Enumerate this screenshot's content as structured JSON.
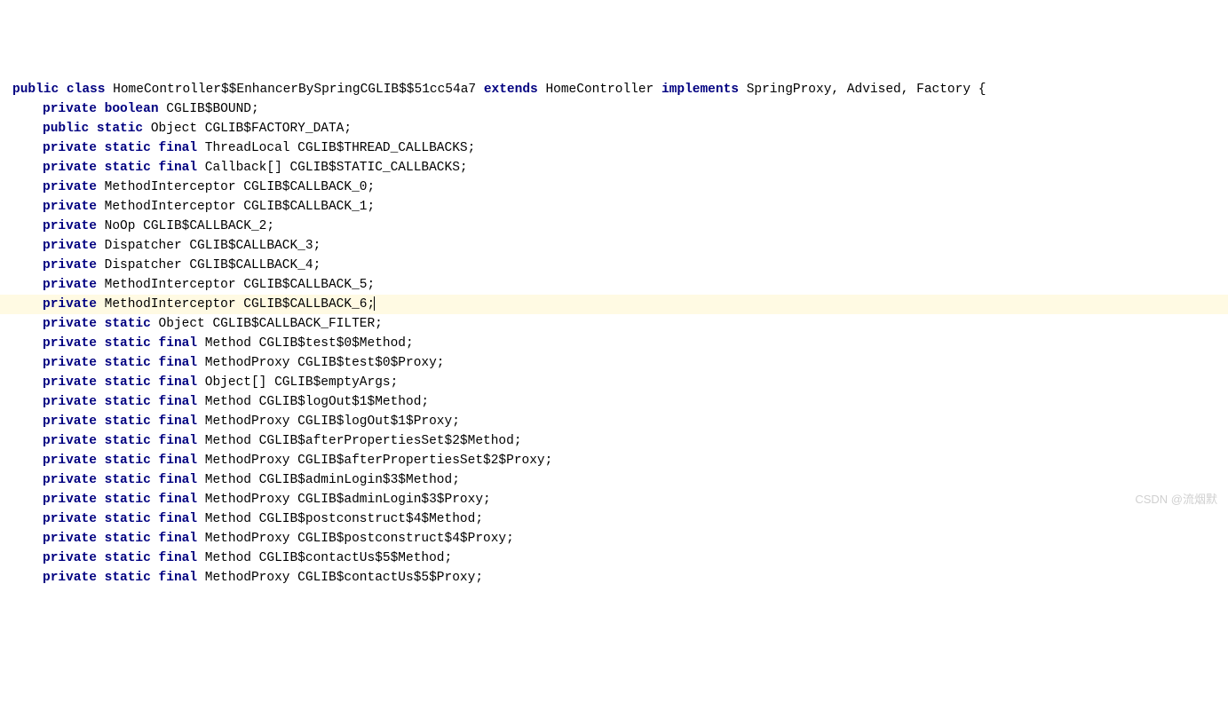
{
  "watermark": "CSDN @流烟默",
  "code": {
    "lines": [
      {
        "indented": false,
        "highlighted": false,
        "tokens": [
          {
            "type": "kw",
            "text": "public"
          },
          {
            "type": "space",
            "text": " "
          },
          {
            "type": "kw",
            "text": "class"
          },
          {
            "type": "space",
            "text": " "
          },
          {
            "type": "ident",
            "text": "HomeController$$EnhancerBySpringCGLIB$$51cc54a7"
          },
          {
            "type": "space",
            "text": " "
          },
          {
            "type": "kw",
            "text": "extends"
          },
          {
            "type": "space",
            "text": " "
          },
          {
            "type": "ident",
            "text": "HomeController"
          },
          {
            "type": "space",
            "text": " "
          },
          {
            "type": "kw",
            "text": "implements"
          },
          {
            "type": "space",
            "text": " "
          },
          {
            "type": "ident",
            "text": "SpringProxy, Advised, Factory {"
          }
        ]
      },
      {
        "indented": true,
        "highlighted": false,
        "tokens": [
          {
            "type": "kw",
            "text": "private"
          },
          {
            "type": "space",
            "text": " "
          },
          {
            "type": "kw",
            "text": "boolean"
          },
          {
            "type": "space",
            "text": " "
          },
          {
            "type": "ident",
            "text": "CGLIB$BOUND;"
          }
        ]
      },
      {
        "indented": true,
        "highlighted": false,
        "tokens": [
          {
            "type": "kw",
            "text": "public"
          },
          {
            "type": "space",
            "text": " "
          },
          {
            "type": "kw",
            "text": "static"
          },
          {
            "type": "space",
            "text": " "
          },
          {
            "type": "ident",
            "text": "Object CGLIB$FACTORY_DATA;"
          }
        ]
      },
      {
        "indented": true,
        "highlighted": false,
        "tokens": [
          {
            "type": "kw",
            "text": "private"
          },
          {
            "type": "space",
            "text": " "
          },
          {
            "type": "kw",
            "text": "static"
          },
          {
            "type": "space",
            "text": " "
          },
          {
            "type": "kw",
            "text": "final"
          },
          {
            "type": "space",
            "text": " "
          },
          {
            "type": "ident",
            "text": "ThreadLocal CGLIB$THREAD_CALLBACKS;"
          }
        ]
      },
      {
        "indented": true,
        "highlighted": false,
        "tokens": [
          {
            "type": "kw",
            "text": "private"
          },
          {
            "type": "space",
            "text": " "
          },
          {
            "type": "kw",
            "text": "static"
          },
          {
            "type": "space",
            "text": " "
          },
          {
            "type": "kw",
            "text": "final"
          },
          {
            "type": "space",
            "text": " "
          },
          {
            "type": "ident",
            "text": "Callback[] CGLIB$STATIC_CALLBACKS;"
          }
        ]
      },
      {
        "indented": true,
        "highlighted": false,
        "tokens": [
          {
            "type": "kw",
            "text": "private"
          },
          {
            "type": "space",
            "text": " "
          },
          {
            "type": "ident",
            "text": "MethodInterceptor CGLIB$CALLBACK_0;"
          }
        ]
      },
      {
        "indented": true,
        "highlighted": false,
        "tokens": [
          {
            "type": "kw",
            "text": "private"
          },
          {
            "type": "space",
            "text": " "
          },
          {
            "type": "ident",
            "text": "MethodInterceptor CGLIB$CALLBACK_1;"
          }
        ]
      },
      {
        "indented": true,
        "highlighted": false,
        "tokens": [
          {
            "type": "kw",
            "text": "private"
          },
          {
            "type": "space",
            "text": " "
          },
          {
            "type": "ident",
            "text": "NoOp CGLIB$CALLBACK_2;"
          }
        ]
      },
      {
        "indented": true,
        "highlighted": false,
        "tokens": [
          {
            "type": "kw",
            "text": "private"
          },
          {
            "type": "space",
            "text": " "
          },
          {
            "type": "ident",
            "text": "Dispatcher CGLIB$CALLBACK_3;"
          }
        ]
      },
      {
        "indented": true,
        "highlighted": false,
        "tokens": [
          {
            "type": "kw",
            "text": "private"
          },
          {
            "type": "space",
            "text": " "
          },
          {
            "type": "ident",
            "text": "Dispatcher CGLIB$CALLBACK_4;"
          }
        ]
      },
      {
        "indented": true,
        "highlighted": false,
        "tokens": [
          {
            "type": "kw",
            "text": "private"
          },
          {
            "type": "space",
            "text": " "
          },
          {
            "type": "ident",
            "text": "MethodInterceptor CGLIB$CALLBACK_5;"
          }
        ]
      },
      {
        "indented": true,
        "highlighted": true,
        "cursor": true,
        "tokens": [
          {
            "type": "kw",
            "text": "private"
          },
          {
            "type": "space",
            "text": " "
          },
          {
            "type": "ident",
            "text": "MethodInterceptor CGLIB$CALLBACK_6;"
          }
        ]
      },
      {
        "indented": true,
        "highlighted": false,
        "tokens": [
          {
            "type": "kw",
            "text": "private"
          },
          {
            "type": "space",
            "text": " "
          },
          {
            "type": "kw",
            "text": "static"
          },
          {
            "type": "space",
            "text": " "
          },
          {
            "type": "ident",
            "text": "Object CGLIB$CALLBACK_FILTER;"
          }
        ]
      },
      {
        "indented": true,
        "highlighted": false,
        "tokens": [
          {
            "type": "kw",
            "text": "private"
          },
          {
            "type": "space",
            "text": " "
          },
          {
            "type": "kw",
            "text": "static"
          },
          {
            "type": "space",
            "text": " "
          },
          {
            "type": "kw",
            "text": "final"
          },
          {
            "type": "space",
            "text": " "
          },
          {
            "type": "ident",
            "text": "Method CGLIB$test$0$Method;"
          }
        ]
      },
      {
        "indented": true,
        "highlighted": false,
        "tokens": [
          {
            "type": "kw",
            "text": "private"
          },
          {
            "type": "space",
            "text": " "
          },
          {
            "type": "kw",
            "text": "static"
          },
          {
            "type": "space",
            "text": " "
          },
          {
            "type": "kw",
            "text": "final"
          },
          {
            "type": "space",
            "text": " "
          },
          {
            "type": "ident",
            "text": "MethodProxy CGLIB$test$0$Proxy;"
          }
        ]
      },
      {
        "indented": true,
        "highlighted": false,
        "tokens": [
          {
            "type": "kw",
            "text": "private"
          },
          {
            "type": "space",
            "text": " "
          },
          {
            "type": "kw",
            "text": "static"
          },
          {
            "type": "space",
            "text": " "
          },
          {
            "type": "kw",
            "text": "final"
          },
          {
            "type": "space",
            "text": " "
          },
          {
            "type": "ident",
            "text": "Object[] CGLIB$emptyArgs;"
          }
        ]
      },
      {
        "indented": true,
        "highlighted": false,
        "tokens": [
          {
            "type": "kw",
            "text": "private"
          },
          {
            "type": "space",
            "text": " "
          },
          {
            "type": "kw",
            "text": "static"
          },
          {
            "type": "space",
            "text": " "
          },
          {
            "type": "kw",
            "text": "final"
          },
          {
            "type": "space",
            "text": " "
          },
          {
            "type": "ident",
            "text": "Method CGLIB$logOut$1$Method;"
          }
        ]
      },
      {
        "indented": true,
        "highlighted": false,
        "tokens": [
          {
            "type": "kw",
            "text": "private"
          },
          {
            "type": "space",
            "text": " "
          },
          {
            "type": "kw",
            "text": "static"
          },
          {
            "type": "space",
            "text": " "
          },
          {
            "type": "kw",
            "text": "final"
          },
          {
            "type": "space",
            "text": " "
          },
          {
            "type": "ident",
            "text": "MethodProxy CGLIB$logOut$1$Proxy;"
          }
        ]
      },
      {
        "indented": true,
        "highlighted": false,
        "tokens": [
          {
            "type": "kw",
            "text": "private"
          },
          {
            "type": "space",
            "text": " "
          },
          {
            "type": "kw",
            "text": "static"
          },
          {
            "type": "space",
            "text": " "
          },
          {
            "type": "kw",
            "text": "final"
          },
          {
            "type": "space",
            "text": " "
          },
          {
            "type": "ident",
            "text": "Method CGLIB$afterPropertiesSet$2$Method;"
          }
        ]
      },
      {
        "indented": true,
        "highlighted": false,
        "tokens": [
          {
            "type": "kw",
            "text": "private"
          },
          {
            "type": "space",
            "text": " "
          },
          {
            "type": "kw",
            "text": "static"
          },
          {
            "type": "space",
            "text": " "
          },
          {
            "type": "kw",
            "text": "final"
          },
          {
            "type": "space",
            "text": " "
          },
          {
            "type": "ident",
            "text": "MethodProxy CGLIB$afterPropertiesSet$2$Proxy;"
          }
        ]
      },
      {
        "indented": true,
        "highlighted": false,
        "tokens": [
          {
            "type": "kw",
            "text": "private"
          },
          {
            "type": "space",
            "text": " "
          },
          {
            "type": "kw",
            "text": "static"
          },
          {
            "type": "space",
            "text": " "
          },
          {
            "type": "kw",
            "text": "final"
          },
          {
            "type": "space",
            "text": " "
          },
          {
            "type": "ident",
            "text": "Method CGLIB$adminLogin$3$Method;"
          }
        ]
      },
      {
        "indented": true,
        "highlighted": false,
        "tokens": [
          {
            "type": "kw",
            "text": "private"
          },
          {
            "type": "space",
            "text": " "
          },
          {
            "type": "kw",
            "text": "static"
          },
          {
            "type": "space",
            "text": " "
          },
          {
            "type": "kw",
            "text": "final"
          },
          {
            "type": "space",
            "text": " "
          },
          {
            "type": "ident",
            "text": "MethodProxy CGLIB$adminLogin$3$Proxy;"
          }
        ]
      },
      {
        "indented": true,
        "highlighted": false,
        "tokens": [
          {
            "type": "kw",
            "text": "private"
          },
          {
            "type": "space",
            "text": " "
          },
          {
            "type": "kw",
            "text": "static"
          },
          {
            "type": "space",
            "text": " "
          },
          {
            "type": "kw",
            "text": "final"
          },
          {
            "type": "space",
            "text": " "
          },
          {
            "type": "ident",
            "text": "Method CGLIB$postconstruct$4$Method;"
          }
        ]
      },
      {
        "indented": true,
        "highlighted": false,
        "tokens": [
          {
            "type": "kw",
            "text": "private"
          },
          {
            "type": "space",
            "text": " "
          },
          {
            "type": "kw",
            "text": "static"
          },
          {
            "type": "space",
            "text": " "
          },
          {
            "type": "kw",
            "text": "final"
          },
          {
            "type": "space",
            "text": " "
          },
          {
            "type": "ident",
            "text": "MethodProxy CGLIB$postconstruct$4$Proxy;"
          }
        ]
      },
      {
        "indented": true,
        "highlighted": false,
        "tokens": [
          {
            "type": "kw",
            "text": "private"
          },
          {
            "type": "space",
            "text": " "
          },
          {
            "type": "kw",
            "text": "static"
          },
          {
            "type": "space",
            "text": " "
          },
          {
            "type": "kw",
            "text": "final"
          },
          {
            "type": "space",
            "text": " "
          },
          {
            "type": "ident",
            "text": "Method CGLIB$contactUs$5$Method;"
          }
        ]
      },
      {
        "indented": true,
        "highlighted": false,
        "tokens": [
          {
            "type": "kw",
            "text": "private"
          },
          {
            "type": "space",
            "text": " "
          },
          {
            "type": "kw",
            "text": "static"
          },
          {
            "type": "space",
            "text": " "
          },
          {
            "type": "kw",
            "text": "final"
          },
          {
            "type": "space",
            "text": " "
          },
          {
            "type": "ident",
            "text": "MethodProxy CGLIB$contactUs$5$Proxy;"
          }
        ]
      }
    ]
  }
}
